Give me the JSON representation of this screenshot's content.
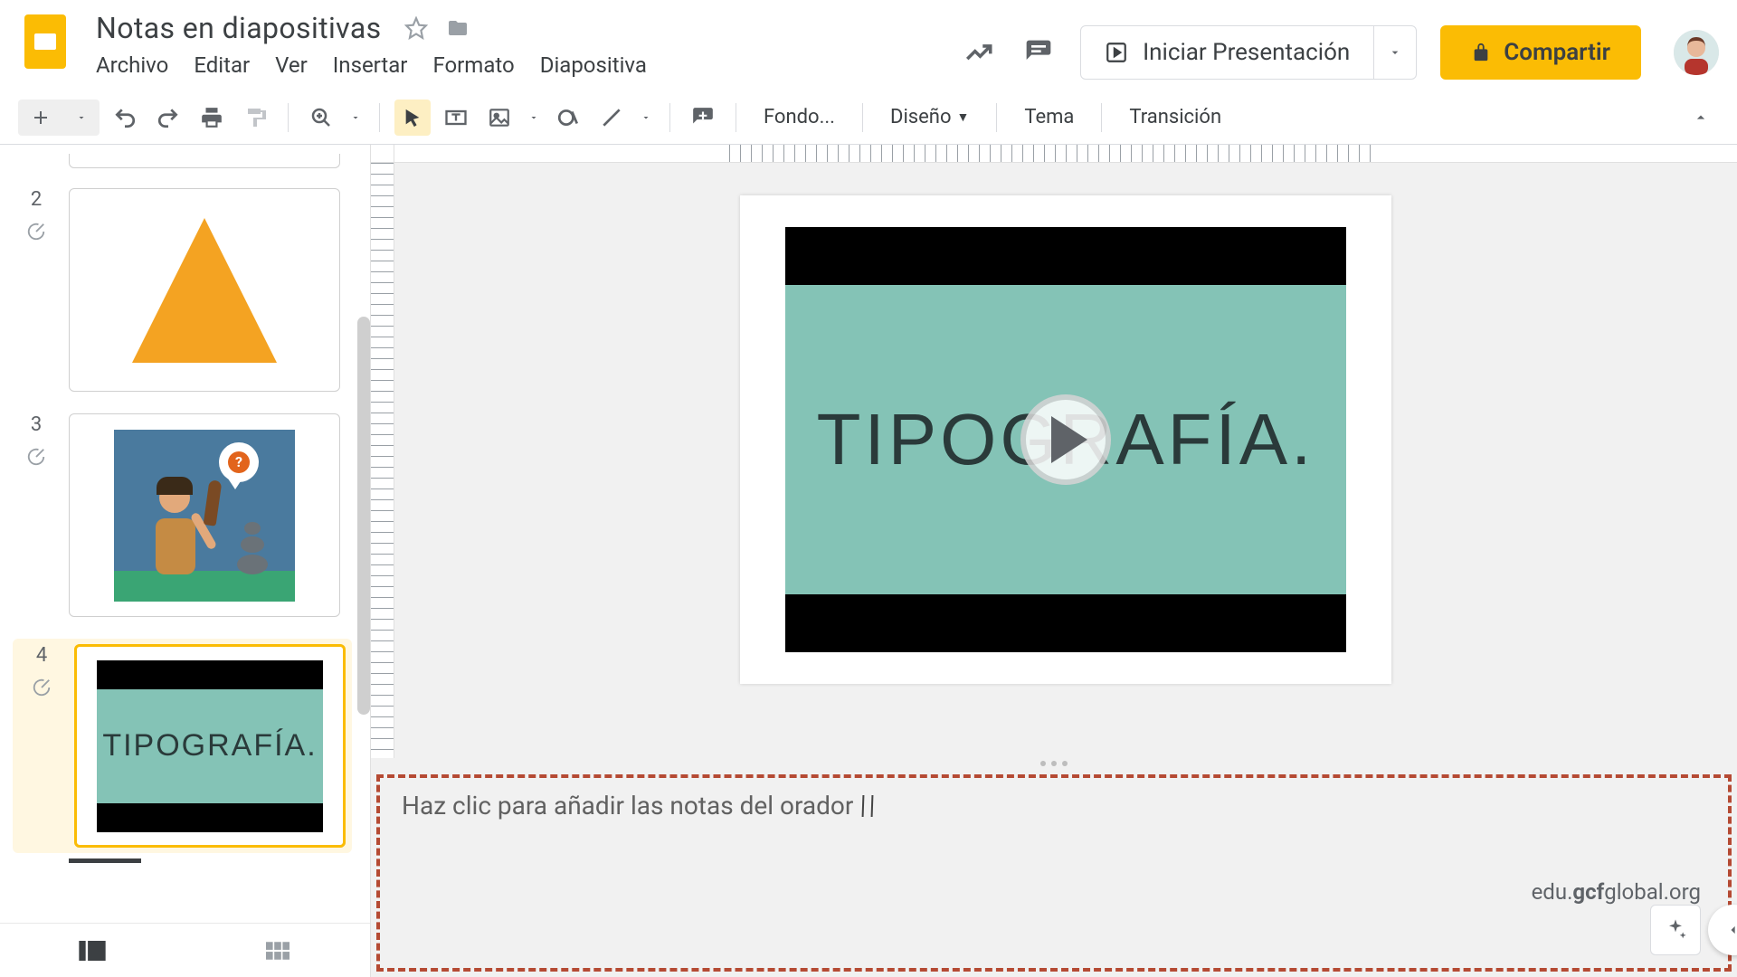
{
  "header": {
    "doc_title": "Notas en diapositivas",
    "menus": [
      "Archivo",
      "Editar",
      "Ver",
      "Insertar",
      "Formato",
      "Diapositiva"
    ],
    "present_label": "Iniciar Presentación",
    "share_label": "Compartir"
  },
  "toolbar": {
    "background_label": "Fondo...",
    "layout_label": "Diseño",
    "theme_label": "Tema",
    "transition_label": "Transición"
  },
  "thumbnails": {
    "items": [
      {
        "num": "2"
      },
      {
        "num": "3"
      },
      {
        "num": "4"
      }
    ],
    "tipo_label": "TIPOGRAFÍA."
  },
  "canvas": {
    "video_text": "TIPOGRAFÍA."
  },
  "notes": {
    "placeholder": "Haz clic para añadir las notas del orador"
  },
  "watermark": {
    "t1": "edu.",
    "t2": "gcf",
    "t3": "global.org"
  }
}
